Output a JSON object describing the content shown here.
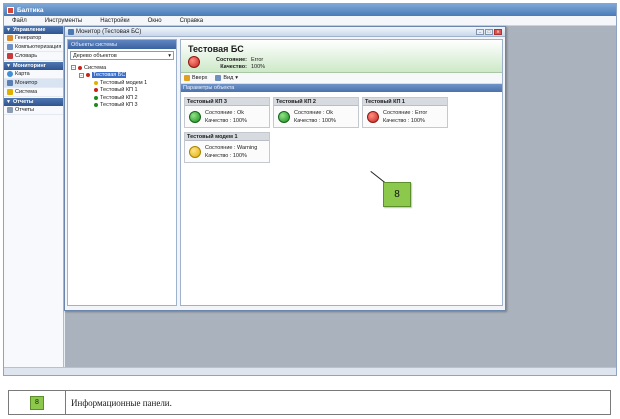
{
  "app": {
    "title": "Балтика",
    "menu": [
      "Файл",
      "Инструменты",
      "Настройки",
      "Окно",
      "Справка"
    ]
  },
  "leftnav": {
    "groups": [
      {
        "header": "Управление",
        "items": [
          {
            "label": "Генератор",
            "icon": "generator-icon"
          },
          {
            "label": "Компьютеризация",
            "icon": "computer-icon"
          },
          {
            "label": "Словарь",
            "icon": "dictionary-icon"
          }
        ]
      },
      {
        "header": "Мониторинг",
        "items": [
          {
            "label": "Карта",
            "icon": "globe-icon"
          },
          {
            "label": "Монитор",
            "icon": "monitor-icon"
          },
          {
            "label": "Система",
            "icon": "system-icon"
          }
        ]
      },
      {
        "header": "Отчеты",
        "items": [
          {
            "label": "Отчеты",
            "icon": "report-icon"
          }
        ]
      }
    ]
  },
  "monitor": {
    "title": "Монитор (Тестовая БС)",
    "tree_header": "Объекты системы",
    "tree_combo": "Дерево объектов",
    "tree": {
      "root": "Система",
      "selected": "Тестовая БС",
      "children": [
        {
          "label": "Тестовый модем 1",
          "color": "#e0b000"
        },
        {
          "label": "Тестовый КП 1",
          "color": "#c8231a"
        },
        {
          "label": "Тестовый КП 2",
          "color": "#1d8a1a"
        },
        {
          "label": "Тестовый КП 3",
          "color": "#1d8a1a"
        }
      ]
    },
    "header": {
      "title": "Тестовая БС",
      "state_label": "Состояние:",
      "state_value": "Error",
      "quality_label": "Качество:",
      "quality_value": "100%"
    },
    "toolbar": {
      "up_label": "Вверх",
      "view_label": "Вид"
    },
    "section_title": "Параметры объекта",
    "panels": [
      {
        "title": "Тестовый КП 3",
        "state": "Состояние : Ok",
        "quality": "Качество : 100%",
        "status": "ok"
      },
      {
        "title": "Тестовый КП 2",
        "state": "Состояние : Ok",
        "quality": "Качество : 100%",
        "status": "ok"
      },
      {
        "title": "Тестовый КП 1",
        "state": "Состояние : Error",
        "quality": "Качество : 100%",
        "status": "err"
      },
      {
        "title": "Тестовый модем 1",
        "state": "Состояние : Warning",
        "quality": "Качество : 100%",
        "status": "warn"
      }
    ]
  },
  "callout": {
    "number": "8"
  },
  "legend": {
    "number": "8",
    "text": "Информационные панели."
  },
  "colors": {
    "ok": "#1d8a1a",
    "error": "#c8231a",
    "warning": "#e0b000",
    "callout": "#8cc84b",
    "header_accent": "#cde9c8"
  }
}
